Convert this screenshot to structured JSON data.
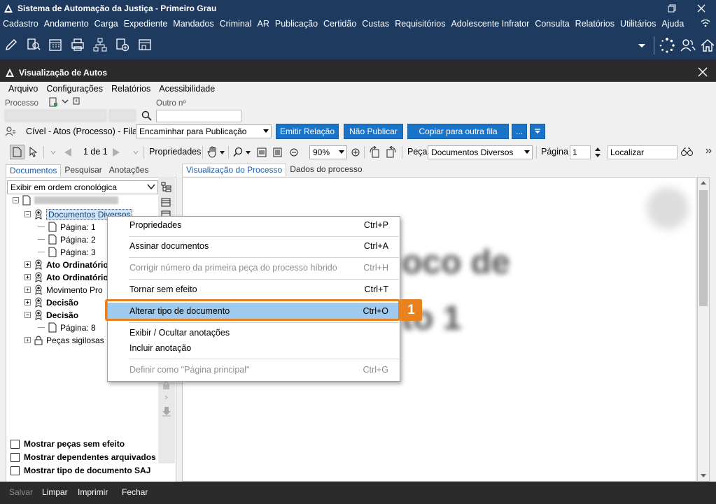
{
  "app": {
    "title": "Sistema de Automação da Justiça - Primeiro Grau",
    "menu": [
      "Cadastro",
      "Andamento",
      "Carga",
      "Expediente",
      "Mandados",
      "Criminal",
      "AR",
      "Publicação",
      "Certidão",
      "Custas",
      "Requisitórios",
      "Adolescente Infrator",
      "Consulta",
      "Relatórios",
      "Utilitários",
      "Ajuda"
    ],
    "toolbar_icons": [
      "edit-icon",
      "search-doc-icon",
      "calendar-icon",
      "print-icon",
      "hierarchy-icon",
      "add-doc-icon",
      "window-icon"
    ],
    "right_icons": [
      "dropdown-arrow-icon",
      "loading-icon",
      "users-icon",
      "home-icon"
    ]
  },
  "window": {
    "title": "Visualização de Autos",
    "menu": [
      {
        "label": "Arquivo",
        "u": "A"
      },
      {
        "label": "Configurações",
        "u": "C"
      },
      {
        "label": "Relatórios",
        "u": "R"
      },
      {
        "label": "Acessibilidade",
        "u": "A"
      }
    ]
  },
  "processo": {
    "label": "Processo",
    "outro_label": "Outro nº"
  },
  "fila": {
    "context_label": "Cível - Atos (Processo) - Fila:",
    "selected": "Encaminhar para Publicação",
    "buttons": [
      "Emitir Relação",
      "Não Publicar",
      "Copiar para outra fila",
      "..."
    ]
  },
  "doc_toolbar": {
    "page_info": "1 de 1",
    "propriedades": "Propriedades",
    "zoom": "90%",
    "peca_label": "Peça",
    "peca_value": "Documentos Diversos",
    "pagina_label": "Página",
    "pagina_value": "1",
    "localizar_placeholder": "Localizar"
  },
  "left": {
    "tabs": [
      "Documentos",
      "Pesquisar",
      "Anotações"
    ],
    "order_select": "Exibir em ordem cronológica",
    "tree": [
      {
        "label": "Documentos Diversos",
        "bold": false,
        "selected": true
      },
      {
        "label": "Página: 1"
      },
      {
        "label": "Página: 2"
      },
      {
        "label": "Página: 3"
      },
      {
        "label": "Ato Ordinatório",
        "bold": true
      },
      {
        "label": "Ato Ordinatório",
        "bold": true
      },
      {
        "label": "Movimento Pro",
        "bold": false
      },
      {
        "label": "Decisão",
        "bold": true
      },
      {
        "label": "Decisão",
        "bold": true
      },
      {
        "label": "Página: 8"
      },
      {
        "label": "Peças sigilosas"
      }
    ],
    "checkboxes": [
      "Mostrar peças sem efeito",
      "Mostrar dependentes arquivados",
      "Mostrar tipo de documento SAJ"
    ]
  },
  "right": {
    "tabs": [
      "Visualização do Processo",
      "Dados do processo"
    ],
    "blur_text": [
      "oco de",
      "to 1"
    ]
  },
  "bottom": {
    "buttons": [
      {
        "label": "Salvar",
        "disabled": true
      },
      {
        "label": "Limpar",
        "disabled": false
      },
      {
        "label": "Imprimir",
        "disabled": false
      },
      {
        "label": "Fechar",
        "disabled": false
      }
    ]
  },
  "context_menu": {
    "items": [
      {
        "label": "Propriedades",
        "shortcut": "Ctrl+P",
        "disabled": false
      },
      {
        "label": "Assinar documentos",
        "shortcut": "Ctrl+A",
        "disabled": false
      },
      {
        "label": "Corrigir número da primeira peça do processo híbrido",
        "shortcut": "Ctrl+H",
        "disabled": true
      },
      {
        "label": "Tornar sem efeito",
        "shortcut": "Ctrl+T",
        "disabled": false
      },
      {
        "label": "Alterar tipo de documento",
        "shortcut": "Ctrl+O",
        "disabled": false,
        "highlighted": true
      },
      {
        "label": "Exibir / Ocultar anotações",
        "shortcut": "",
        "disabled": false
      },
      {
        "label": "Incluir anotação",
        "shortcut": "",
        "disabled": false
      },
      {
        "label": "Definir como \"Página principal\"",
        "shortcut": "Ctrl+G",
        "disabled": true
      }
    ],
    "callout_number": "1"
  },
  "colors": {
    "app_header": "#1e3a5f",
    "inner_header": "#2b2b2b",
    "accent_blue": "#1a75c8",
    "highlight": "#9fcaef",
    "callout": "#e8821e"
  }
}
